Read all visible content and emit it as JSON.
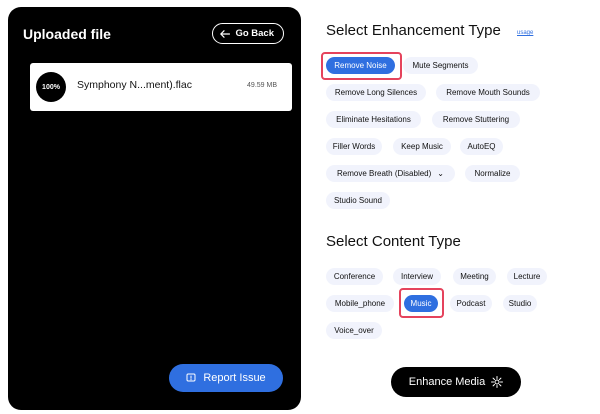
{
  "left_panel": {
    "title": "Uploaded file",
    "go_back_label": "Go Back",
    "file": {
      "progress": "100%",
      "name": "Symphony N...ment).flac",
      "size": "49.59 MB"
    },
    "report_label": "Report Issue"
  },
  "enhancement": {
    "title": "Select Enhancement Type",
    "usage_label": "usage",
    "options": [
      {
        "label": "Remove Noise",
        "selected": true
      },
      {
        "label": "Mute Segments"
      },
      {
        "label": "Remove Long Silences"
      },
      {
        "label": "Remove Mouth Sounds"
      },
      {
        "label": "Eliminate Hesitations"
      },
      {
        "label": "Remove Stuttering"
      },
      {
        "label": "Filler Words"
      },
      {
        "label": "Keep Music"
      },
      {
        "label": "AutoEQ"
      },
      {
        "label": "Remove Breath  (Disabled)"
      },
      {
        "label": "Normalize"
      },
      {
        "label": "Studio Sound"
      }
    ]
  },
  "content": {
    "title": "Select Content Type",
    "options": [
      {
        "label": "Conference"
      },
      {
        "label": "Interview"
      },
      {
        "label": "Meeting"
      },
      {
        "label": "Lecture"
      },
      {
        "label": "Mobile_phone"
      },
      {
        "label": "Music",
        "selected": true
      },
      {
        "label": "Podcast"
      },
      {
        "label": "Studio"
      },
      {
        "label": "Voice_over"
      }
    ]
  },
  "enhance_button_label": "Enhance Media",
  "colors": {
    "accent": "#2f6fe0",
    "chip_bg": "#f1f3fc",
    "highlight": "#e5435c",
    "panel_bg": "#000000"
  }
}
